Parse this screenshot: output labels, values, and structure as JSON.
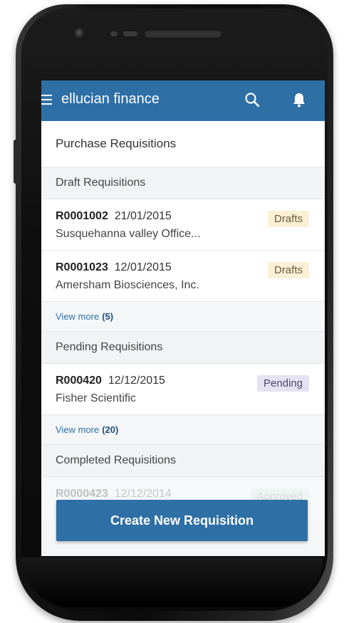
{
  "app": {
    "title": "ellucian finance",
    "menu_icon": "hamburger-menu-icon",
    "search_icon": "search-icon",
    "notification_icon": "bell-icon",
    "accent_color": "#2e6fa6"
  },
  "page": {
    "title": "Purchase Requisitions"
  },
  "sections": {
    "draft": {
      "header": "Draft Requisitions",
      "items": [
        {
          "id": "R0001002",
          "date": "21/01/2015",
          "vendor": "Susquehanna valley Office...",
          "status": "Drafts"
        },
        {
          "id": "R0001023",
          "date": "12/01/2015",
          "vendor": "Amersham Biosciences, Inc.",
          "status": "Drafts"
        }
      ],
      "view_more_label": "View more",
      "view_more_count": "(5)"
    },
    "pending": {
      "header": "Pending Requisitions",
      "items": [
        {
          "id": "R000420",
          "date": "12/12/2015",
          "vendor": "Fisher Scientific",
          "status": "Pending"
        }
      ],
      "view_more_label": "View more",
      "view_more_count": "(20)"
    },
    "completed": {
      "header": "Completed Requisitions",
      "items": [
        {
          "id": "R0000423",
          "date": "12/12/2014",
          "status": "Approved"
        }
      ]
    }
  },
  "actions": {
    "create_label": "Create New Requisition"
  }
}
